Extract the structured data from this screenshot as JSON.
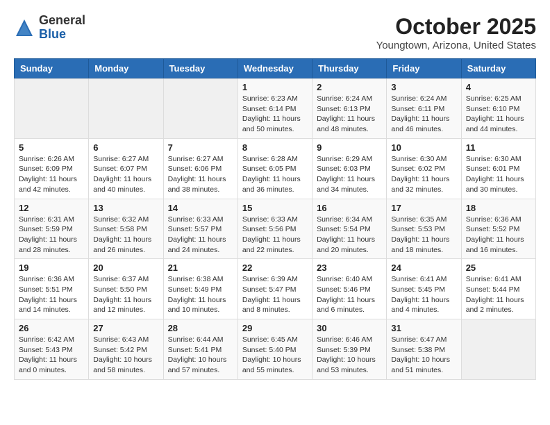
{
  "header": {
    "logo_general": "General",
    "logo_blue": "Blue",
    "month_title": "October 2025",
    "location": "Youngtown, Arizona, United States"
  },
  "weekdays": [
    "Sunday",
    "Monday",
    "Tuesday",
    "Wednesday",
    "Thursday",
    "Friday",
    "Saturday"
  ],
  "weeks": [
    [
      {
        "day": "",
        "info": ""
      },
      {
        "day": "",
        "info": ""
      },
      {
        "day": "",
        "info": ""
      },
      {
        "day": "1",
        "info": "Sunrise: 6:23 AM\nSunset: 6:14 PM\nDaylight: 11 hours\nand 50 minutes."
      },
      {
        "day": "2",
        "info": "Sunrise: 6:24 AM\nSunset: 6:13 PM\nDaylight: 11 hours\nand 48 minutes."
      },
      {
        "day": "3",
        "info": "Sunrise: 6:24 AM\nSunset: 6:11 PM\nDaylight: 11 hours\nand 46 minutes."
      },
      {
        "day": "4",
        "info": "Sunrise: 6:25 AM\nSunset: 6:10 PM\nDaylight: 11 hours\nand 44 minutes."
      }
    ],
    [
      {
        "day": "5",
        "info": "Sunrise: 6:26 AM\nSunset: 6:09 PM\nDaylight: 11 hours\nand 42 minutes."
      },
      {
        "day": "6",
        "info": "Sunrise: 6:27 AM\nSunset: 6:07 PM\nDaylight: 11 hours\nand 40 minutes."
      },
      {
        "day": "7",
        "info": "Sunrise: 6:27 AM\nSunset: 6:06 PM\nDaylight: 11 hours\nand 38 minutes."
      },
      {
        "day": "8",
        "info": "Sunrise: 6:28 AM\nSunset: 6:05 PM\nDaylight: 11 hours\nand 36 minutes."
      },
      {
        "day": "9",
        "info": "Sunrise: 6:29 AM\nSunset: 6:03 PM\nDaylight: 11 hours\nand 34 minutes."
      },
      {
        "day": "10",
        "info": "Sunrise: 6:30 AM\nSunset: 6:02 PM\nDaylight: 11 hours\nand 32 minutes."
      },
      {
        "day": "11",
        "info": "Sunrise: 6:30 AM\nSunset: 6:01 PM\nDaylight: 11 hours\nand 30 minutes."
      }
    ],
    [
      {
        "day": "12",
        "info": "Sunrise: 6:31 AM\nSunset: 5:59 PM\nDaylight: 11 hours\nand 28 minutes."
      },
      {
        "day": "13",
        "info": "Sunrise: 6:32 AM\nSunset: 5:58 PM\nDaylight: 11 hours\nand 26 minutes."
      },
      {
        "day": "14",
        "info": "Sunrise: 6:33 AM\nSunset: 5:57 PM\nDaylight: 11 hours\nand 24 minutes."
      },
      {
        "day": "15",
        "info": "Sunrise: 6:33 AM\nSunset: 5:56 PM\nDaylight: 11 hours\nand 22 minutes."
      },
      {
        "day": "16",
        "info": "Sunrise: 6:34 AM\nSunset: 5:54 PM\nDaylight: 11 hours\nand 20 minutes."
      },
      {
        "day": "17",
        "info": "Sunrise: 6:35 AM\nSunset: 5:53 PM\nDaylight: 11 hours\nand 18 minutes."
      },
      {
        "day": "18",
        "info": "Sunrise: 6:36 AM\nSunset: 5:52 PM\nDaylight: 11 hours\nand 16 minutes."
      }
    ],
    [
      {
        "day": "19",
        "info": "Sunrise: 6:36 AM\nSunset: 5:51 PM\nDaylight: 11 hours\nand 14 minutes."
      },
      {
        "day": "20",
        "info": "Sunrise: 6:37 AM\nSunset: 5:50 PM\nDaylight: 11 hours\nand 12 minutes."
      },
      {
        "day": "21",
        "info": "Sunrise: 6:38 AM\nSunset: 5:49 PM\nDaylight: 11 hours\nand 10 minutes."
      },
      {
        "day": "22",
        "info": "Sunrise: 6:39 AM\nSunset: 5:47 PM\nDaylight: 11 hours\nand 8 minutes."
      },
      {
        "day": "23",
        "info": "Sunrise: 6:40 AM\nSunset: 5:46 PM\nDaylight: 11 hours\nand 6 minutes."
      },
      {
        "day": "24",
        "info": "Sunrise: 6:41 AM\nSunset: 5:45 PM\nDaylight: 11 hours\nand 4 minutes."
      },
      {
        "day": "25",
        "info": "Sunrise: 6:41 AM\nSunset: 5:44 PM\nDaylight: 11 hours\nand 2 minutes."
      }
    ],
    [
      {
        "day": "26",
        "info": "Sunrise: 6:42 AM\nSunset: 5:43 PM\nDaylight: 11 hours\nand 0 minutes."
      },
      {
        "day": "27",
        "info": "Sunrise: 6:43 AM\nSunset: 5:42 PM\nDaylight: 10 hours\nand 58 minutes."
      },
      {
        "day": "28",
        "info": "Sunrise: 6:44 AM\nSunset: 5:41 PM\nDaylight: 10 hours\nand 57 minutes."
      },
      {
        "day": "29",
        "info": "Sunrise: 6:45 AM\nSunset: 5:40 PM\nDaylight: 10 hours\nand 55 minutes."
      },
      {
        "day": "30",
        "info": "Sunrise: 6:46 AM\nSunset: 5:39 PM\nDaylight: 10 hours\nand 53 minutes."
      },
      {
        "day": "31",
        "info": "Sunrise: 6:47 AM\nSunset: 5:38 PM\nDaylight: 10 hours\nand 51 minutes."
      },
      {
        "day": "",
        "info": ""
      }
    ]
  ]
}
